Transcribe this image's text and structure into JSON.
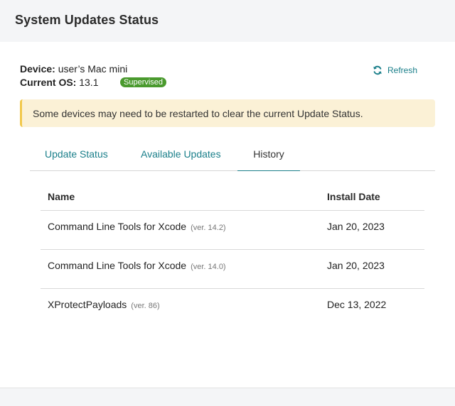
{
  "header": {
    "title": "System Updates Status"
  },
  "device": {
    "device_label": "Device:",
    "device_value": "user’s Mac mini",
    "os_label": "Current OS:",
    "os_value": "13.1",
    "badge": "Supervised"
  },
  "refresh": {
    "label": "Refresh",
    "icon": "refresh-icon"
  },
  "alert": {
    "text": "Some devices may need to be restarted to clear the current Update Status."
  },
  "tabs": [
    {
      "label": "Update Status",
      "active": false
    },
    {
      "label": "Available Updates",
      "active": false
    },
    {
      "label": "History",
      "active": true
    }
  ],
  "table": {
    "columns": [
      "Name",
      "Install Date"
    ],
    "rows": [
      {
        "name": "Command Line Tools for Xcode",
        "version": "(ver. 14.2)",
        "date": "Jan 20, 2023"
      },
      {
        "name": "Command Line Tools for Xcode",
        "version": "(ver. 14.0)",
        "date": "Jan 20, 2023"
      },
      {
        "name": "XProtectPayloads",
        "version": "(ver. 86)",
        "date": "Dec 13, 2022"
      }
    ]
  },
  "colors": {
    "accent": "#1a7f8a",
    "badge": "#4a9a2e",
    "alert_bg": "#fbf1d6",
    "alert_border": "#f1c84b"
  }
}
